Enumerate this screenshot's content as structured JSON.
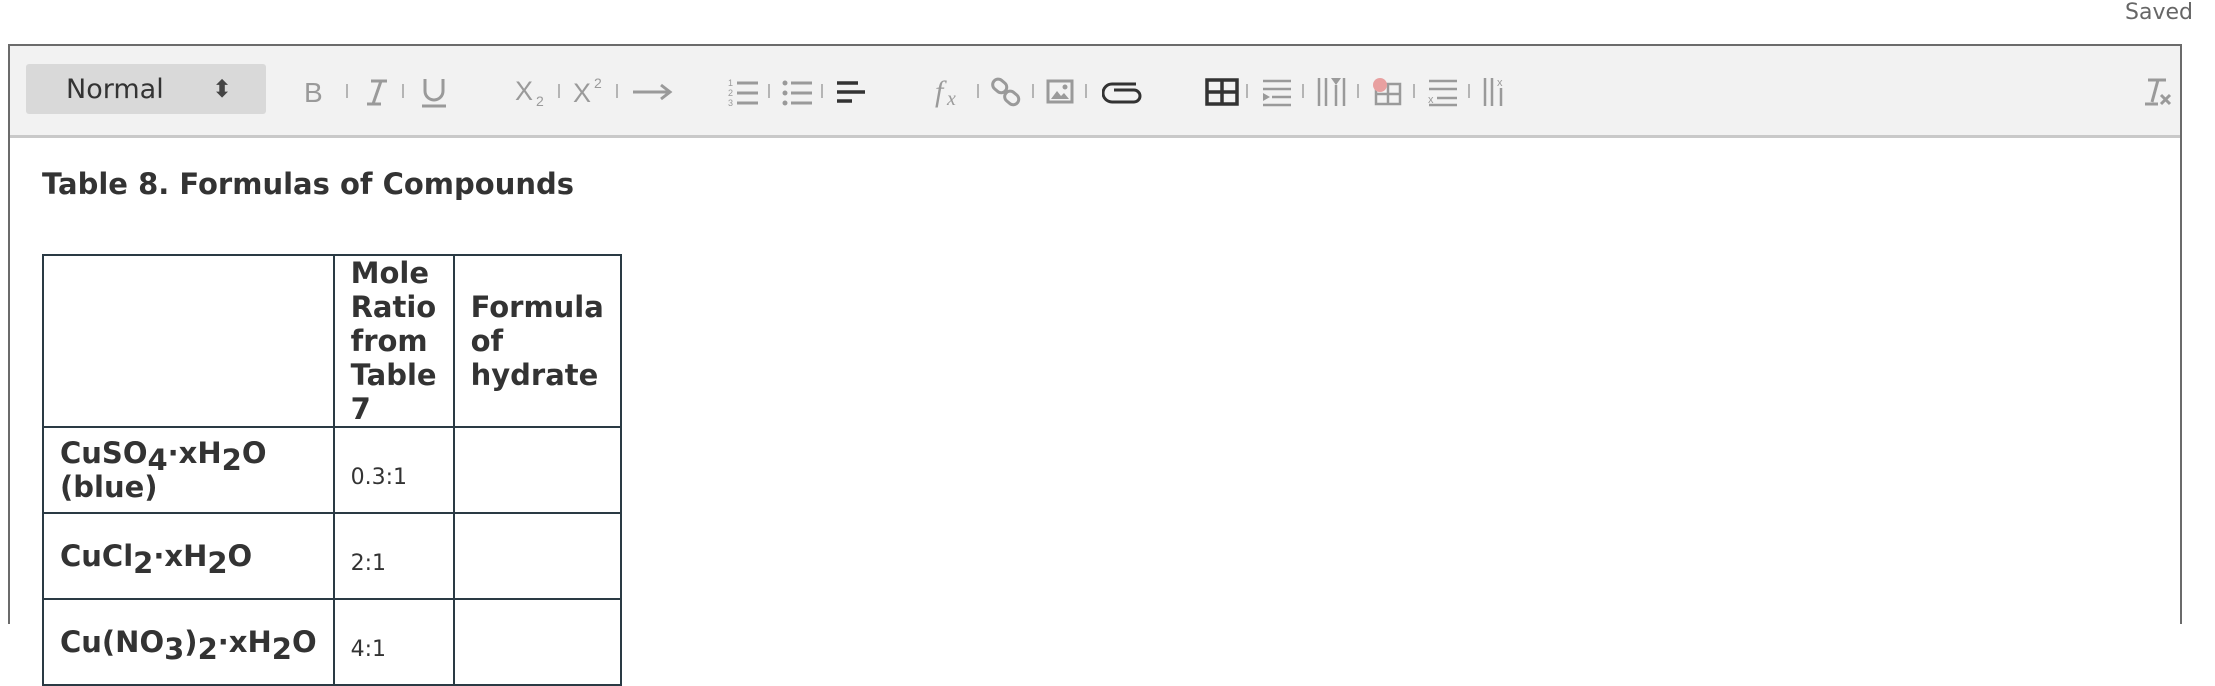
{
  "status": {
    "saved": "Saved"
  },
  "toolbar": {
    "format_select": "Normal",
    "buttons": [
      "bold-button",
      "italic-button",
      "underline-button",
      "subscript-button",
      "superscript-button",
      "arrow-button",
      "ordered-list-button",
      "bullet-list-button",
      "align-button",
      "formula-button",
      "link-button",
      "image-button",
      "attach-button",
      "table-button",
      "insert-row-button",
      "insert-column-button",
      "cell-button",
      "delete-row-button",
      "delete-column-button",
      "clear-format-button"
    ]
  },
  "content": {
    "caption": "Table 8. Formulas of Compounds",
    "headers": [
      "",
      "Mole Ratio from Table 7",
      "Formula of hydrate"
    ],
    "rows": [
      {
        "compound_parts": [
          "CuSO",
          "4",
          "·xH",
          "2",
          "O (blue)"
        ],
        "ratio": "0.3:1",
        "formula": ""
      },
      {
        "compound_parts": [
          "CuCl",
          "2",
          "·xH",
          "2",
          "O"
        ],
        "ratio": "2:1",
        "formula": ""
      },
      {
        "compound_parts": [
          "Cu(NO",
          "3",
          ")",
          "2",
          "·xH",
          "2",
          "O"
        ],
        "ratio": "4:1",
        "formula": ""
      }
    ]
  },
  "colors": {
    "border": "#2a3a44",
    "toolbar_bg": "#f2f2f2",
    "select_bg": "#d9d9d9",
    "icon": "#9a9a9a",
    "icon_dark": "#333333"
  }
}
